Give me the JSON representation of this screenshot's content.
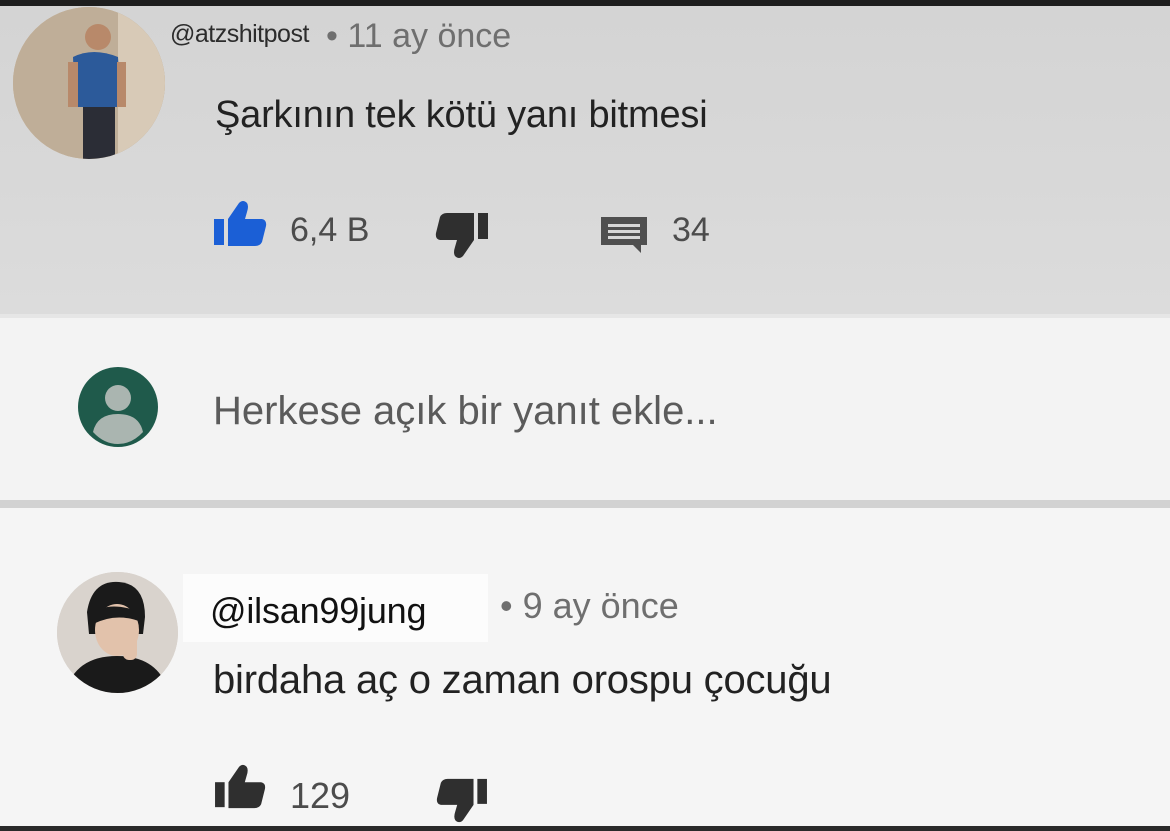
{
  "comments": [
    {
      "username": "@atzshitpost",
      "meta": "• 11 ay önce",
      "text": "Şarkının tek kötü yanı bitmesi",
      "likes": "6,4 B",
      "replies": "34",
      "colors": {
        "like_icon": "#1b5fd6",
        "dislike_icon": "#2f2f2f"
      }
    },
    {
      "username": "@ilsan99jung",
      "meta": "• 9 ay önce",
      "text": "birdaha aç o zaman orospu çocuğu",
      "likes": "129",
      "colors": {
        "like_icon": "#2f2f2f",
        "dislike_icon": "#2f2f2f"
      }
    }
  ],
  "reply_box": {
    "placeholder": "Herkese açık bir yanıt ekle...",
    "avatar_color": "#1f5a4b"
  },
  "icons": {
    "like": "thumbs-up-icon",
    "dislike": "thumbs-down-icon",
    "reply": "comment-icon",
    "user_placeholder": "account-circle-icon"
  }
}
